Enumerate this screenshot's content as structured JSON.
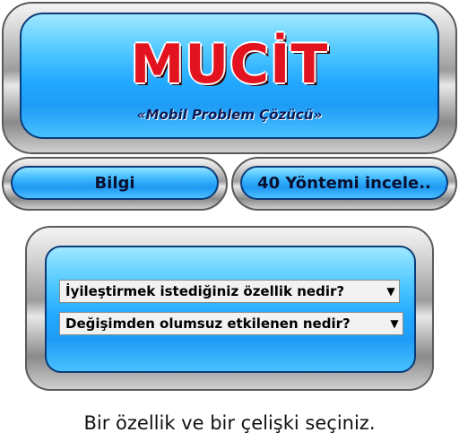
{
  "header": {
    "logo_text": "MUCİT",
    "tagline": "«Mobil Problem Çözücü»"
  },
  "buttons": {
    "info_label": "Bilgi",
    "methods_label": "40 Yöntemi incele.."
  },
  "selectors": {
    "feature_selected": "İyileştirmek istediğiniz özellik nedir?",
    "negative_selected": "Değişimden olumsuz etkilenen nedir?",
    "arrow_glyph": "▼"
  },
  "footer": {
    "instruction": "Bir özellik ve bir çelişki seçiniz."
  },
  "colors": {
    "logo_red": "#e2121e",
    "panel_blue": "#22a9ff",
    "frame_border": "#0a3b7a"
  }
}
